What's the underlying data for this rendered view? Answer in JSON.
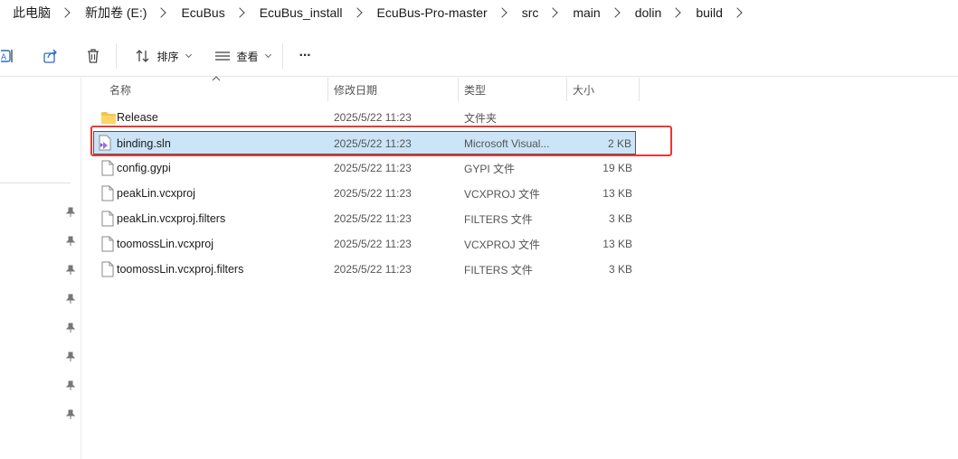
{
  "breadcrumb": [
    "此电脑",
    "新加卷 (E:)",
    "EcuBus",
    "EcuBus_install",
    "EcuBus-Pro-master",
    "src",
    "main",
    "dolin",
    "build"
  ],
  "toolbar": {
    "sort_label": "排序",
    "view_label": "查看",
    "more_label": "···"
  },
  "columns": {
    "name": "名称",
    "date": "修改日期",
    "type": "类型",
    "size": "大小"
  },
  "files": [
    {
      "name": "Release",
      "date": "2025/5/22 11:23",
      "type": "文件夹",
      "size": "",
      "icon": "folder-icon"
    },
    {
      "name": "binding.sln",
      "date": "2025/5/22 11:23",
      "type": "Microsoft Visual...",
      "size": "2 KB",
      "icon": "visual-studio-solution-icon"
    },
    {
      "name": "config.gypi",
      "date": "2025/5/22 11:23",
      "type": "GYPI 文件",
      "size": "19 KB",
      "icon": "file-icon"
    },
    {
      "name": "peakLin.vcxproj",
      "date": "2025/5/22 11:23",
      "type": "VCXPROJ 文件",
      "size": "13 KB",
      "icon": "file-icon"
    },
    {
      "name": "peakLin.vcxproj.filters",
      "date": "2025/5/22 11:23",
      "type": "FILTERS 文件",
      "size": "3 KB",
      "icon": "file-icon"
    },
    {
      "name": "toomossLin.vcxproj",
      "date": "2025/5/22 11:23",
      "type": "VCXPROJ 文件",
      "size": "13 KB",
      "icon": "file-icon"
    },
    {
      "name": "toomossLin.vcxproj.filters",
      "date": "2025/5/22 11:23",
      "type": "FILTERS 文件",
      "size": "3 KB",
      "icon": "file-icon"
    }
  ],
  "colors": {
    "selection": "#cce4f7",
    "highlight": "#e53935",
    "folder": "#f5c542"
  }
}
